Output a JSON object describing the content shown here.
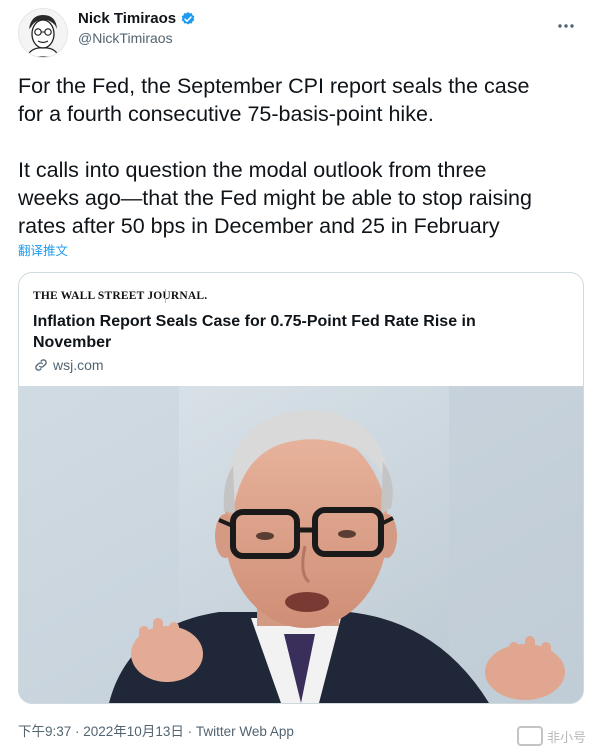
{
  "author": {
    "name": "Nick Timiraos",
    "handle": "@NickTimiraos",
    "avatar_icon": "portrait-sketch",
    "verified_color": "#1d9bf0"
  },
  "tweet": {
    "text": "For the Fed, the September CPI report seals the case\nfor a fourth consecutive 75-basis-point hike.\n\nIt calls into question the modal outlook from three\nweeks ago—that the Fed might be able to stop raising\nrates after 50 bps in December and 25 in February",
    "translate_label": "翻译推文"
  },
  "card": {
    "publisher": "THE WALL STREET JOURNAL.",
    "title": "Inflation Report Seals Case for 0.75-Point Fed Rate Rise in November",
    "domain": "wsj.com",
    "link_icon": "link-icon",
    "image_subject": "man-with-glasses-speaking"
  },
  "footer": {
    "meta": "下午9:37 · 2022年10月13日 · Twitter Web App"
  },
  "watermark": {
    "label": "非小号"
  },
  "colors": {
    "text": "#0f1419",
    "secondary": "#536471",
    "accent": "#1d9bf0",
    "border": "#cfd9de"
  }
}
